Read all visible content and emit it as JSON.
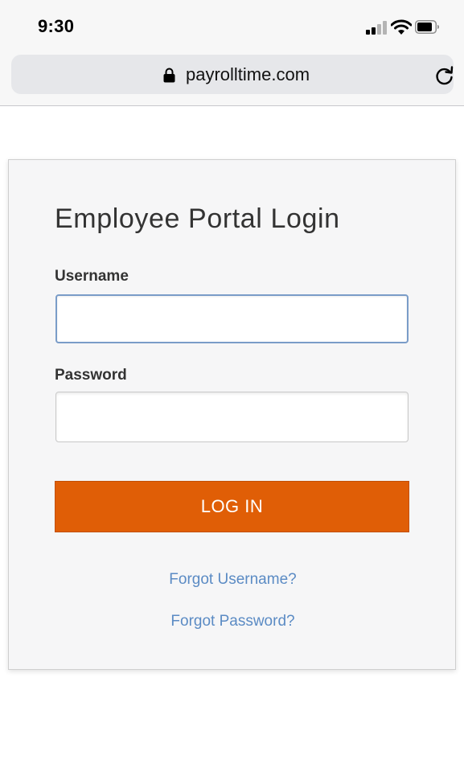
{
  "status_bar": {
    "time": "9:30"
  },
  "browser": {
    "url": "payrolltime.com",
    "icons": [
      "lock-icon",
      "reload-icon"
    ]
  },
  "login": {
    "title": "Employee Portal Login",
    "username_label": "Username",
    "username_value": "",
    "password_label": "Password",
    "password_value": "",
    "button_label": "LOG IN",
    "forgot_username": "Forgot Username?",
    "forgot_password": "Forgot Password?"
  },
  "colors": {
    "button": "#e05e06",
    "link": "#5b8bc4",
    "focus_border": "#7a9cc8"
  }
}
